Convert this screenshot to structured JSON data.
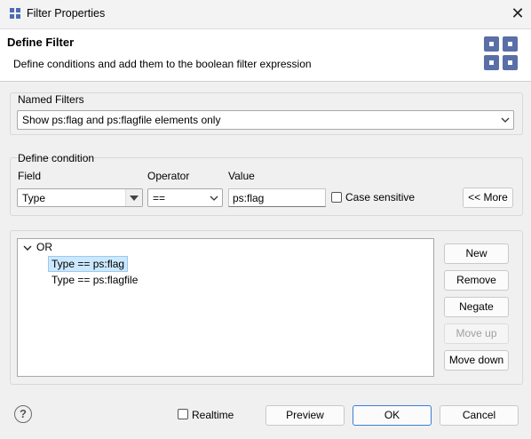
{
  "window": {
    "title": "Filter Properties",
    "close_glyph": "✕"
  },
  "header": {
    "title": "Define Filter",
    "description": "Define conditions and add them to the boolean filter expression",
    "logo_icon": "grid-logo-icon",
    "logo_color": "#5a6fa8"
  },
  "named_filters": {
    "legend": "Named Filters",
    "selected": "Show ps:flag and ps:flagfile elements only"
  },
  "define_condition": {
    "legend": "Define condition",
    "field_label": "Field",
    "operator_label": "Operator",
    "value_label": "Value",
    "field_value": "Type",
    "operator_value": "==",
    "value_value": "ps:flag",
    "case_sensitive_label": "Case sensitive",
    "case_sensitive_checked": false,
    "more_button": "<< More"
  },
  "expression_tree": {
    "root": "OR",
    "items": [
      {
        "label": "Type == ps:flag",
        "selected": true
      },
      {
        "label": "Type == ps:flagfile",
        "selected": false
      }
    ]
  },
  "tree_buttons": {
    "new": "New",
    "remove": "Remove",
    "negate": "Negate",
    "move_up": "Move up",
    "move_down": "Move down"
  },
  "footer": {
    "help_glyph": "?",
    "realtime_label": "Realtime",
    "realtime_checked": false,
    "preview": "Preview",
    "ok": "OK",
    "cancel": "Cancel"
  },
  "colors": {
    "accent": "#3b7dd8",
    "selection": "#cce8ff"
  }
}
